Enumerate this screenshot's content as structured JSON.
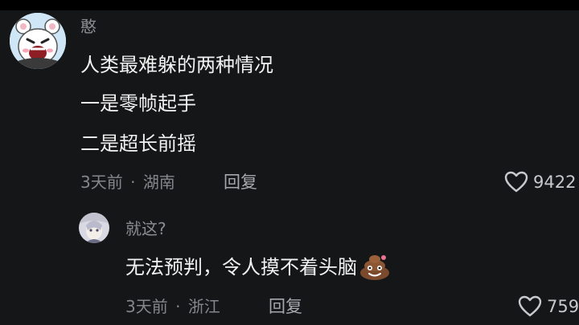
{
  "comment": {
    "username": "憨",
    "lines": [
      "人类最难躲的两种情况",
      "一是零帧起手",
      "二是超长前摇"
    ],
    "time": "3天前",
    "location": "湖南",
    "meta_separator": "·",
    "reply_label": "回复",
    "likes": "9422"
  },
  "reply": {
    "username": "就这?",
    "text": "无法预判，令人摸不着头脑",
    "emoji_icon": "smiling-poop-emoji",
    "time": "3天前",
    "location": "浙江",
    "meta_separator": "·",
    "reply_label": "回复",
    "likes": "759"
  },
  "icons": {
    "like": "heart-outline-icon"
  },
  "colors": {
    "background": "#151618",
    "primary_text": "#f2f2f2",
    "secondary_text": "#8b8d92"
  }
}
